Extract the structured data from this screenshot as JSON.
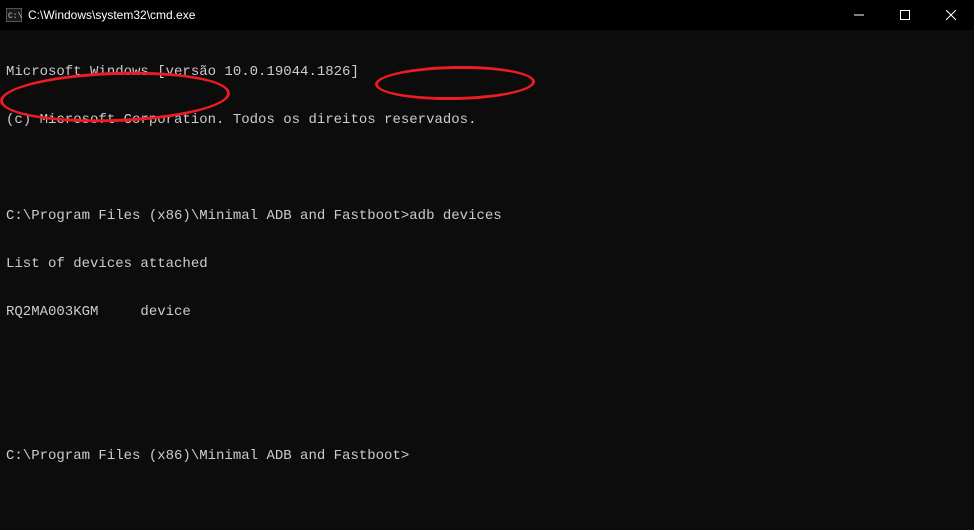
{
  "window": {
    "title": "C:\\Windows\\system32\\cmd.exe"
  },
  "terminal": {
    "line1": "Microsoft Windows [versão 10.0.19044.1826]",
    "line2": "(c) Microsoft Corporation. Todos os direitos reservados.",
    "blank1": "",
    "prompt1_path": "C:\\Program Files (x86)\\Minimal ADB and Fastboot>",
    "prompt1_cmd": "adb devices",
    "output1": "List of devices attached",
    "output2": "RQ2MA003KGM     device",
    "blank2": "",
    "blank3": "",
    "prompt2_path": "C:\\Program Files (x86)\\Minimal ADB and Fastboot>",
    "prompt2_cmd": ""
  }
}
